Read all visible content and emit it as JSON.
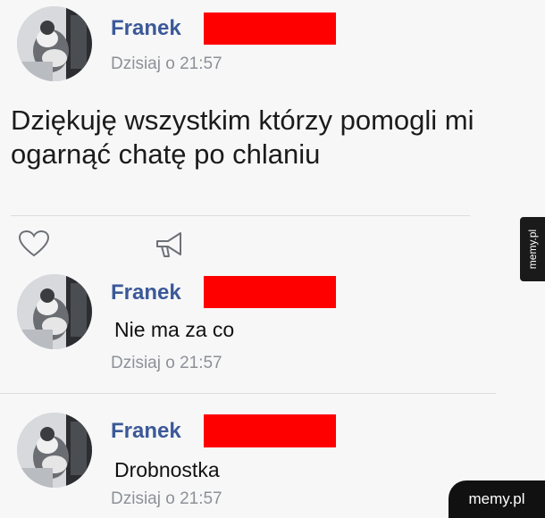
{
  "post": {
    "author": "Franek",
    "time": "Dzisiaj o 21:57",
    "text": "Dziękuję wszystkim którzy pomogli mi ogarnąć chatę po chlaniu",
    "actions": {
      "like_icon": "heart-icon",
      "share_icon": "megaphone-icon"
    }
  },
  "comments": [
    {
      "author": "Franek",
      "text": "Nie ma za co",
      "time": "Dzisiaj o 21:57"
    },
    {
      "author": "Franek",
      "text": "Drobnostka",
      "time": "Dzisiaj o 21:57"
    }
  ],
  "watermark": {
    "side": "memy.pl",
    "corner": "memy.pl"
  },
  "colors": {
    "name": "#3b5998",
    "redaction": "#fe0000",
    "time": "#8d9196",
    "background": "#f7f7f8"
  }
}
